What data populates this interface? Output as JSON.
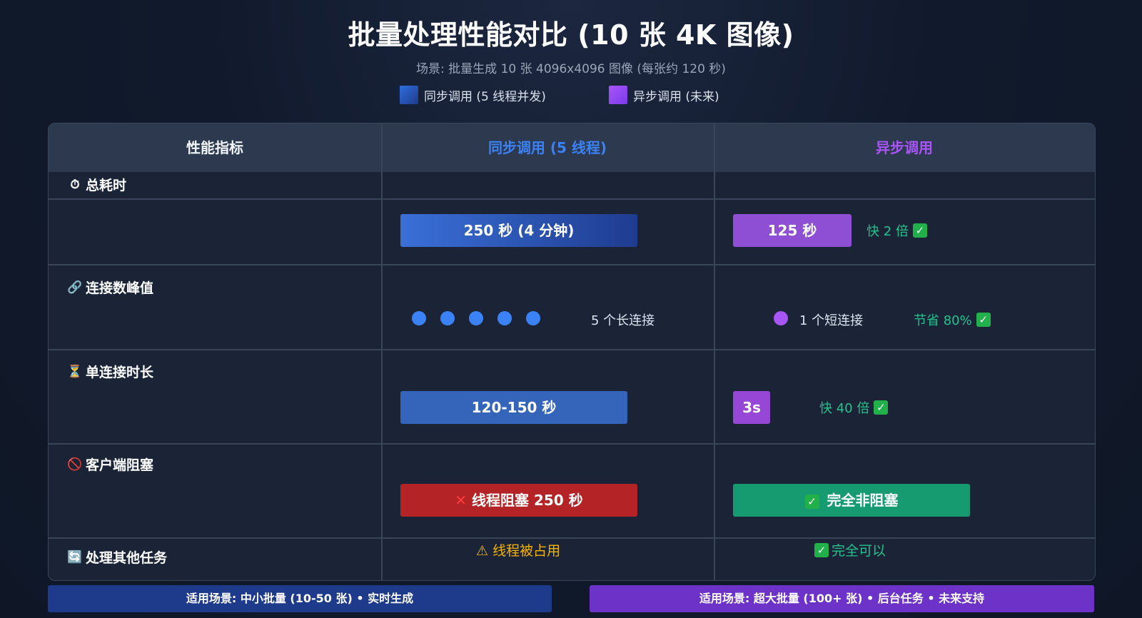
{
  "title": "批量处理性能对比 (10 张 4K 图像)",
  "subtitle": "场景: 批量生成 10 张 4096x4096 图像 (每张约 120 秒)",
  "colors": {
    "sync": "#3b82f6",
    "async": "#a855f7",
    "good": "#22c38e",
    "bad": "#b42326",
    "warn": "#f5b301"
  },
  "legend": [
    {
      "label": "同步调用 (5 线程并发)",
      "color": "#3b82f6"
    },
    {
      "label": "异步调用 (未来)",
      "color": "#a855f7"
    }
  ],
  "table": {
    "headers": [
      "性能指标",
      "同步调用 (5 线程)",
      "异步调用"
    ],
    "rows": {
      "total_time": {
        "metric": "总耗时",
        "icon": "stopwatch-icon",
        "glyph": "⏱",
        "sync_label": "250 秒 (4 分钟)",
        "async_label": "125 秒",
        "note": "快 2 倍"
      },
      "peak_connections": {
        "metric": "连接数峰值",
        "icon": "link-icon",
        "glyph": "🔗",
        "sync_label": "5 个长连接",
        "async_label": "1 个短连接",
        "note": "节省 80%"
      },
      "connection_duration": {
        "metric": "单连接时长",
        "icon": "hourglass-icon",
        "glyph": "⏳",
        "sync_label": "120-150 秒",
        "async_label": "3s",
        "note": "快 40 倍"
      },
      "client_blocking": {
        "metric": "客户端阻塞",
        "icon": "prohibited-icon",
        "glyph": "🚫",
        "sync_label": "线程阻塞 250 秒",
        "async_label": "完全非阻塞",
        "sync_glyph": "✕",
        "async_glyph": "✓"
      },
      "other_tasks": {
        "metric": "处理其他任务",
        "icon": "refresh-icon",
        "glyph": "🔄",
        "sync_label": "线程被占用",
        "sync_glyph": "⚠",
        "async_label": "完全可以",
        "async_glyph": "✓"
      }
    }
  },
  "footer": {
    "sync": "适用场景: 中小批量 (10-50 张) • 实时生成",
    "async": "适用场景: 超大批量 (100+ 张) • 后台任务 • 未来支持"
  },
  "chart_data": [
    {
      "type": "bar",
      "title": "总耗时",
      "categories": [
        "同步调用 (5 线程)",
        "异步调用"
      ],
      "values": [
        250,
        125
      ],
      "unit": "秒"
    },
    {
      "type": "bar",
      "title": "连接数峰值",
      "categories": [
        "同步调用 (5 线程)",
        "异步调用"
      ],
      "values": [
        5,
        1
      ]
    },
    {
      "type": "bar",
      "title": "单连接时长",
      "categories": [
        "同步调用 (5 线程)",
        "异步调用"
      ],
      "values": [
        [
          120,
          150
        ],
        3
      ],
      "unit": "秒"
    },
    {
      "type": "bar",
      "title": "客户端阻塞",
      "categories": [
        "同步调用 (5 线程)",
        "异步调用"
      ],
      "values": [
        250,
        0
      ],
      "unit": "秒"
    }
  ]
}
